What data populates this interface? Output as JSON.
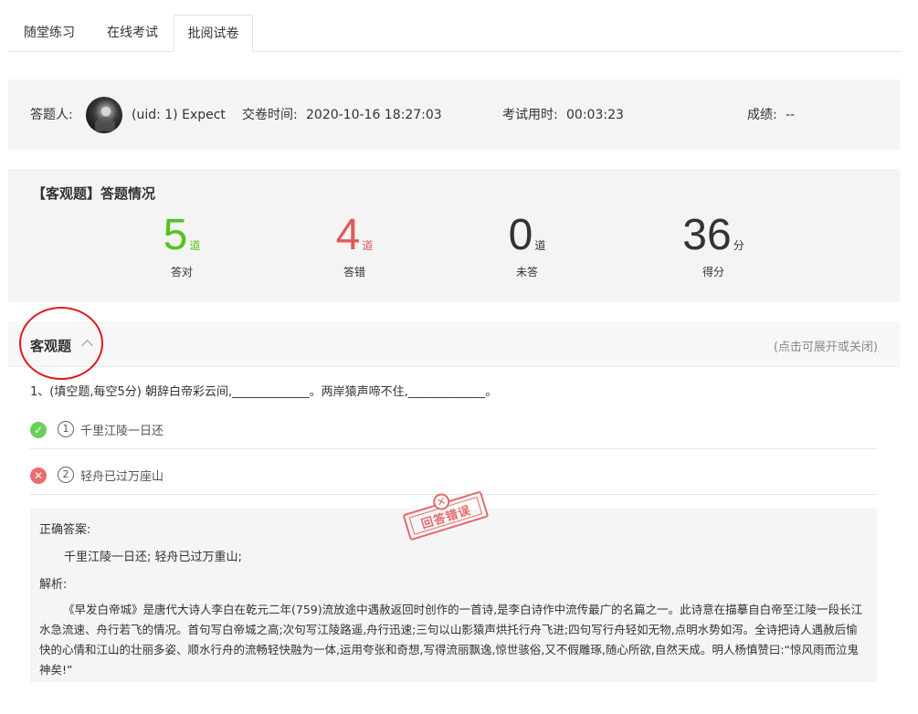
{
  "tabs": [
    {
      "label": "随堂练习"
    },
    {
      "label": "在线考试"
    },
    {
      "label": "批阅试卷"
    }
  ],
  "info": {
    "examinee_label": "答题人:",
    "user": "(uid: 1) Expect",
    "submit_label": "交卷时间:",
    "submit_time": "2020-10-16 18:27:03",
    "duration_label": "考试用时:",
    "duration": "00:03:23",
    "score_label": "成绩:",
    "score": "--"
  },
  "stats": {
    "title": "【客观题】答题情况",
    "items": [
      {
        "value": "5",
        "unit": "道",
        "caption": "答对",
        "color": "#52c41a"
      },
      {
        "value": "4",
        "unit": "道",
        "caption": "答错",
        "color": "#e05a5a"
      },
      {
        "value": "0",
        "unit": "道",
        "caption": "未答",
        "color": "#333333"
      },
      {
        "value": "36",
        "unit": "分",
        "caption": "得分",
        "color": "#333333"
      }
    ]
  },
  "section": {
    "title": "客观题",
    "hint": "(点击可展开或关闭)",
    "question": "1、(填空题,每空5分) 朝辞白帝彩云间,_____________。两岸猿声啼不住,_____________。",
    "answers": [
      {
        "index": "1",
        "text": "千里江陵一日还",
        "status": "correct",
        "icon": "check-icon"
      },
      {
        "index": "2",
        "text": "轻舟已过万座山",
        "status": "wrong",
        "icon": "cross-icon"
      }
    ],
    "stamp": "回答错误",
    "correct_label": "正确答案:",
    "correct_text": "千里江陵一日还; 轻舟已过万重山;",
    "analysis_label": "解析:",
    "analysis_text": "《早发白帝城》是唐代大诗人李白在乾元二年(759)流放途中遇赦返回时创作的一首诗,是李白诗作中流传最广的名篇之一。此诗意在描摹自白帝至江陵一段长江水急流速、舟行若飞的情况。首句写白帝城之高;次句写江陵路遥,舟行迅速;三句以山影猿声烘托行舟飞进;四句写行舟轻如无物,点明水势如泻。全诗把诗人遇赦后愉快的心情和江山的壮丽多姿、顺水行舟的流畅轻快融为一体,运用夸张和奇想,写得流丽飘逸,惊世骇俗,又不假雕琢,随心所欲,自然天成。明人杨慎赞曰:“惊风雨而泣鬼神矣!”"
  }
}
